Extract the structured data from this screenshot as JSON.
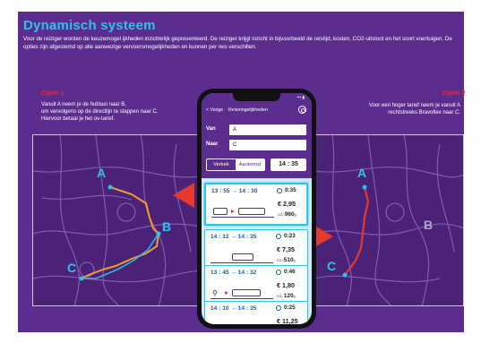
{
  "header": {
    "title": "Dynamisch systeem",
    "intro": "Voor de reiziger worden de keuzemogel ijkheden inzichtelijk gepresenteerd. De reiziger krijgt inzicht in bijvoorbeeld de reistijd, kosten, CO2-uitstoot en het soort voertuigen. De opties zijn afgestemd op alle aanwezige vervoersmogelijkheden en kunnen per reis verschillen."
  },
  "options": {
    "left": {
      "label": "Optie 1",
      "text_lines": [
        "Vanuit A neem je de hubtaxi naar B,",
        "om vervolgens op de directlijn te stappen naar C.",
        "Hiervoor betaal je het ov-tarief."
      ]
    },
    "right": {
      "label": "Optie 2",
      "text_lines": [
        "Voor een hoger tarief neem je vanuit A",
        "rechtstreeks Bravoflex naar C."
      ]
    }
  },
  "map": {
    "point_a": "A",
    "point_b": "B",
    "point_c": "C"
  },
  "phone": {
    "status": "••• ▮",
    "back_label": "< Vorige",
    "screen_title": "Reismogelijkheden",
    "from_label": "Van",
    "from_value": "A",
    "to_label": "Naar",
    "to_value": "C",
    "toggle_depart": "Vertrek",
    "toggle_arrive": "Aankomst",
    "time": "14 : 35",
    "trips": [
      {
        "time": "13 : 55 → 14 : 30",
        "duration": "0:35",
        "cost": "€ 2,95",
        "co2": "960",
        "co2_unit": "g"
      },
      {
        "time": "14 : 12 → 14 : 35",
        "duration": "0:23",
        "cost": "€ 7,35",
        "co2": "510",
        "co2_unit": "g"
      },
      {
        "time": "13 : 45 → 14 : 32",
        "duration": "0:46",
        "cost": "€ 1,80",
        "co2": "120",
        "co2_unit": "g"
      },
      {
        "time": "14 : 10 → 14 : 35",
        "duration": "0:25",
        "cost": "€ 11,25",
        "co2": "",
        "co2_unit": ""
      }
    ]
  },
  "colors": {
    "background": "#5b2d8e",
    "accent": "#2bc4ee",
    "highlight": "#e8283a",
    "route1": "#f39a2e",
    "route2": "#e53a2e"
  }
}
